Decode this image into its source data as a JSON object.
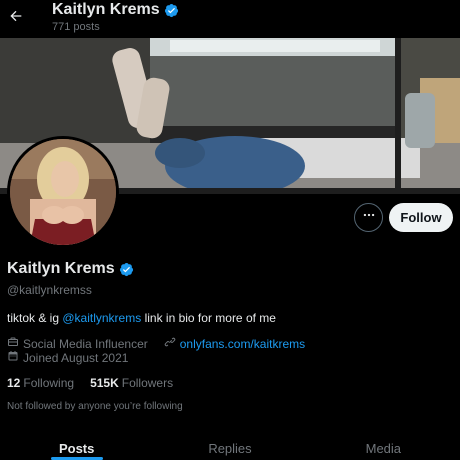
{
  "header": {
    "display_name": "Kaitlyn Krems",
    "post_count": "771 posts"
  },
  "profile": {
    "display_name": "Kaitlyn Krems",
    "handle": "@kaitlynkremss",
    "bio_prefix": "tiktok & ig ",
    "bio_mention": "@kaitlynkrems",
    "bio_suffix": " link in bio for more of me",
    "category": "Social Media Influencer",
    "website": "onlyfans.com/kaitkrems",
    "joined": "Joined August 2021",
    "following_count": "12",
    "following_label": "Following",
    "followers_count": "515K",
    "followers_label": "Followers",
    "followed_by_note": "Not followed by anyone you’re following"
  },
  "actions": {
    "follow_label": "Follow"
  },
  "tabs": [
    {
      "label": "Posts",
      "active": true
    },
    {
      "label": "Replies",
      "active": false
    },
    {
      "label": "Media",
      "active": false
    }
  ],
  "colors": {
    "accent": "#1d9bf0",
    "background": "#000000",
    "text_primary": "#e7e9ea",
    "text_secondary": "#71767b"
  },
  "icons": {
    "back": "arrow-left-icon",
    "verified": "verified-badge-icon",
    "more": "more-horizontal-icon",
    "category": "briefcase-icon",
    "link": "link-icon",
    "calendar": "calendar-icon"
  }
}
